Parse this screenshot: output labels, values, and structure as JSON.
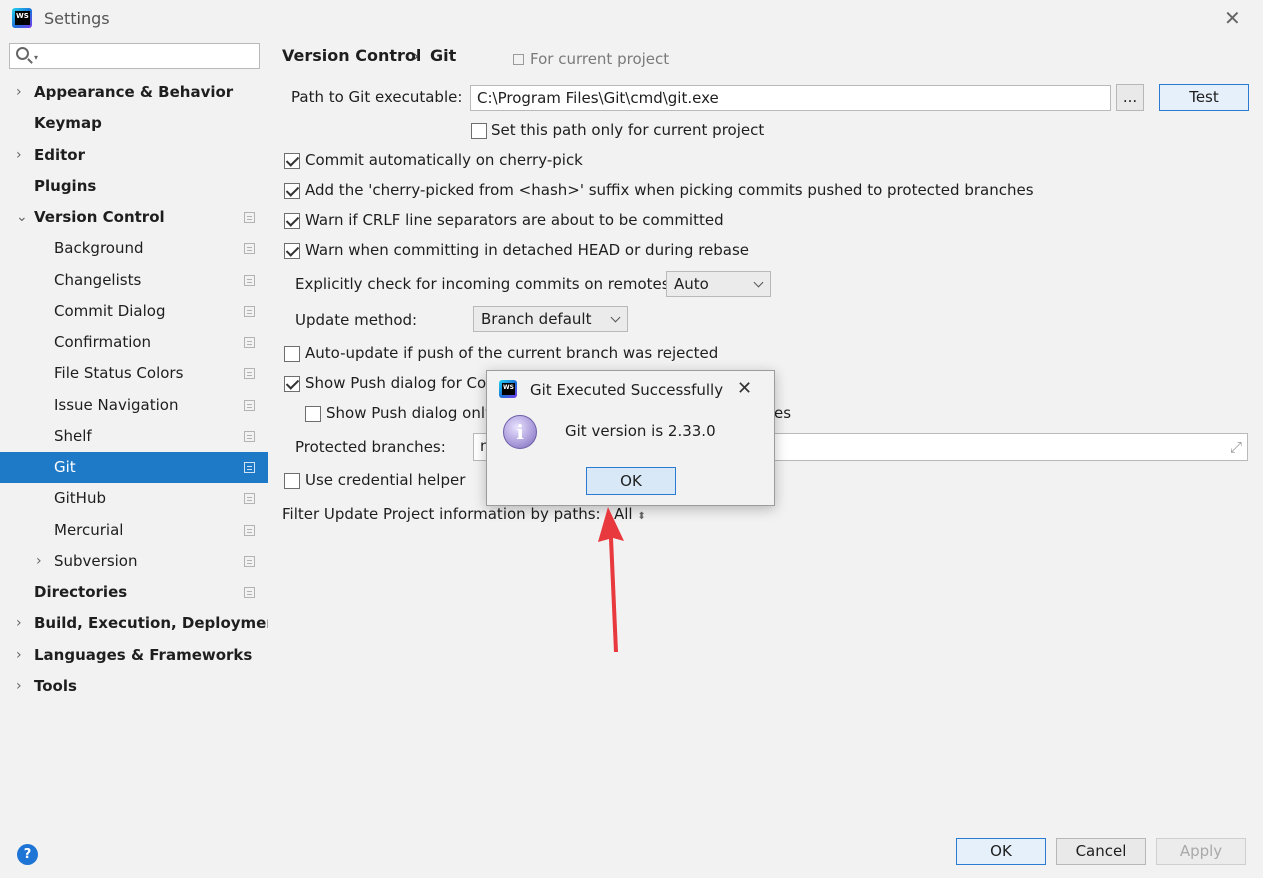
{
  "window": {
    "title": "Settings",
    "close_glyph": "✕"
  },
  "colors": {
    "selection": "#1e79c6",
    "accent": "#2b7bd2",
    "annotation_arrow": "#e8393e"
  },
  "sidebar": {
    "search_placeholder": "",
    "items": [
      {
        "label": "Appearance & Behavior",
        "bold": true,
        "arrow": "›",
        "project_icon": false
      },
      {
        "label": "Keymap",
        "bold": true,
        "arrow": "",
        "project_icon": false
      },
      {
        "label": "Editor",
        "bold": true,
        "arrow": "›",
        "project_icon": false
      },
      {
        "label": "Plugins",
        "bold": true,
        "arrow": "",
        "project_icon": false
      },
      {
        "label": "Version Control",
        "bold": true,
        "arrow": "⌄",
        "project_icon": true
      },
      {
        "label": "Background",
        "bold": false,
        "arrow": "",
        "project_icon": true
      },
      {
        "label": "Changelists",
        "bold": false,
        "arrow": "",
        "project_icon": true
      },
      {
        "label": "Commit Dialog",
        "bold": false,
        "arrow": "",
        "project_icon": true
      },
      {
        "label": "Confirmation",
        "bold": false,
        "arrow": "",
        "project_icon": true
      },
      {
        "label": "File Status Colors",
        "bold": false,
        "arrow": "",
        "project_icon": true
      },
      {
        "label": "Issue Navigation",
        "bold": false,
        "arrow": "",
        "project_icon": true
      },
      {
        "label": "Shelf",
        "bold": false,
        "arrow": "",
        "project_icon": true
      },
      {
        "label": "Git",
        "bold": false,
        "arrow": "",
        "project_icon": true,
        "selected": true
      },
      {
        "label": "GitHub",
        "bold": false,
        "arrow": "",
        "project_icon": true
      },
      {
        "label": "Mercurial",
        "bold": false,
        "arrow": "",
        "project_icon": true
      },
      {
        "label": "Subversion",
        "bold": false,
        "arrow": "›",
        "project_icon": true
      },
      {
        "label": "Directories",
        "bold": true,
        "arrow": "",
        "project_icon": true
      },
      {
        "label": "Build, Execution, Deployment",
        "bold": true,
        "arrow": "›",
        "project_icon": false
      },
      {
        "label": "Languages & Frameworks",
        "bold": true,
        "arrow": "›",
        "project_icon": false
      },
      {
        "label": "Tools",
        "bold": true,
        "arrow": "›",
        "project_icon": false
      }
    ]
  },
  "header": {
    "crumb1": "Version Control",
    "separator": "›",
    "crumb2": "Git",
    "scope_hint": "For current project"
  },
  "git": {
    "path_label": "Path to Git executable:",
    "path_value": "C:\\Program Files\\Git\\cmd\\git.exe",
    "browse_label": "...",
    "test_label": "Test",
    "set_path_only": {
      "label": "Set this path only for current project",
      "checked": false
    },
    "commit_cherry_pick": {
      "label": "Commit automatically on cherry-pick",
      "checked": true
    },
    "cherry_pick_suffix": {
      "label": "Add the 'cherry-picked from <hash>' suffix when picking commits pushed to protected branches",
      "checked": true
    },
    "warn_crlf": {
      "label": "Warn if CRLF line separators are about to be committed",
      "checked": true
    },
    "warn_detached": {
      "label": "Warn when committing in detached HEAD or during rebase",
      "checked": true
    },
    "incoming_label": "Explicitly check for incoming commits on remotes:",
    "incoming_value": "Auto",
    "update_method_label": "Update method:",
    "update_method_value": "Branch default",
    "auto_update": {
      "label": "Auto-update if push of the current branch was rejected",
      "checked": false
    },
    "show_push_dialog": {
      "label": "Show Push dialog for Cor",
      "checked": true
    },
    "show_push_only": {
      "label": "Show Push dialog only",
      "checked": false
    },
    "show_push_only_tail": "es",
    "protected_label": "Protected branches:",
    "protected_value": "m",
    "expand_glyph": "⤢",
    "credential_helper": {
      "label": "Use credential helper",
      "checked": false
    },
    "filter_label": "Filter Update Project information by paths:",
    "filter_value": "All",
    "filter_spinner": "⬍"
  },
  "dialog": {
    "title": "Git Executed Successfully",
    "close_glyph": "✕",
    "icon": "information-icon",
    "message": "Git version is 2.33.0",
    "ok_label": "OK"
  },
  "footer": {
    "help_glyph": "?",
    "ok_label": "OK",
    "cancel_label": "Cancel",
    "apply_label": "Apply"
  }
}
